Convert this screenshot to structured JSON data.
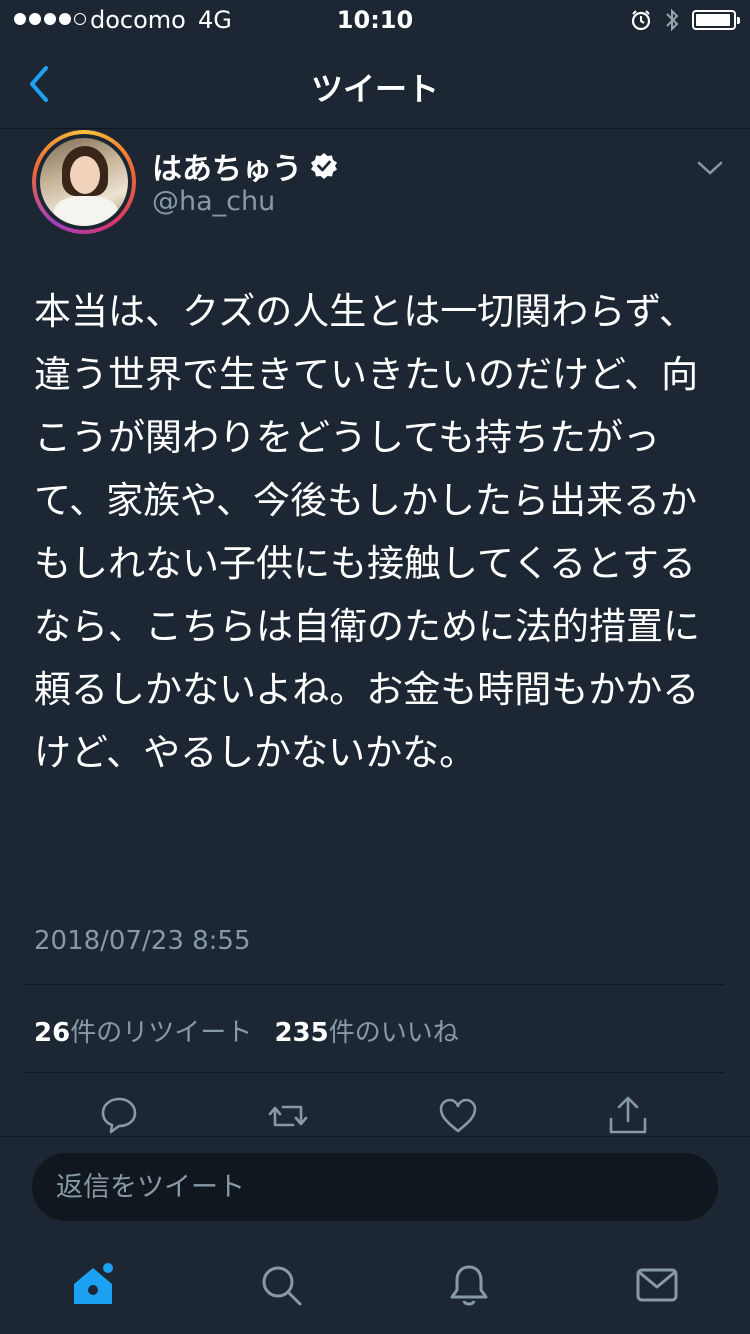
{
  "status_bar": {
    "signal_bars": 4,
    "signal_total": 5,
    "carrier": "docomo",
    "network": "4G",
    "time": "10:10",
    "icons": [
      "alarm-icon",
      "bluetooth-icon",
      "battery-icon"
    ],
    "battery_level": 0.95
  },
  "nav": {
    "title": "ツイート",
    "back_icon": "chevron-left-icon"
  },
  "tweet": {
    "display_name": "はあちゅう",
    "verified_icon": "verified-badge-icon",
    "handle": "@ha_chu",
    "menu_icon": "chevron-down-icon",
    "text": "本当は、クズの人生とは一切関わらず、違う世界で生きていきたいのだけど、向こうが関わりをどうしても持ちたがって、家族や、今後もしかしたら出来るかもしれない子供にも接触してくるとするなら、こちらは自衛のために法的措置に頼るしかないよね。お金も時間もかかるけど、やるしかないかな。",
    "timestamp": "2018/07/23 8:55",
    "retweet_count": "26",
    "retweet_label": "件のリツイート",
    "like_count": "235",
    "like_label": "件のいいね"
  },
  "actions": [
    "reply-icon",
    "retweet-icon",
    "like-icon",
    "share-icon"
  ],
  "reply": {
    "placeholder": "返信をツイート"
  },
  "tabbar": {
    "items": [
      "home-icon",
      "search-icon",
      "notifications-icon",
      "messages-icon"
    ],
    "active": "home-icon"
  },
  "colors": {
    "background": "#1c2733",
    "accent": "#1da1f2",
    "secondary_text": "#8899a6",
    "divider": "#10171e"
  }
}
